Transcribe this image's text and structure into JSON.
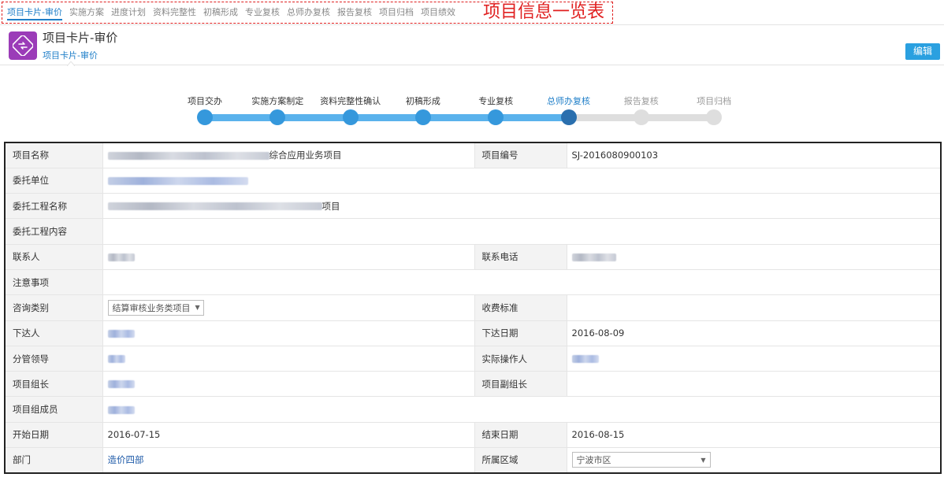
{
  "tabs": [
    {
      "label": "项目卡片-审价",
      "active": true
    },
    {
      "label": "实施方案"
    },
    {
      "label": "进度计划"
    },
    {
      "label": "资料完整性"
    },
    {
      "label": "初稿形成"
    },
    {
      "label": "专业复核"
    },
    {
      "label": "总师办复核"
    },
    {
      "label": "报告复核"
    },
    {
      "label": "项目归档"
    },
    {
      "label": "项目绩效"
    }
  ],
  "annotation": "项目信息一览表",
  "header": {
    "title": "项目卡片-审价",
    "subtitle": "项目卡片-审价",
    "edit_label": "编辑"
  },
  "steps": [
    {
      "label": "项目交办",
      "state": "done"
    },
    {
      "label": "实施方案制定",
      "state": "done"
    },
    {
      "label": "资料完整性确认",
      "state": "done"
    },
    {
      "label": "初稿形成",
      "state": "done"
    },
    {
      "label": "专业复核",
      "state": "done"
    },
    {
      "label": "总师办复核",
      "state": "current"
    },
    {
      "label": "报告复核",
      "state": "pending"
    },
    {
      "label": "项目归档",
      "state": "pending"
    }
  ],
  "form": {
    "project_name_label": "项目名称",
    "project_name_suffix": "综合应用业务项目",
    "project_no_label": "项目编号",
    "project_no": "SJ-2016080900103",
    "client_label": "委托单位",
    "work_name_label": "委托工程名称",
    "work_name_suffix": "项目",
    "work_content_label": "委托工程内容",
    "contact_label": "联系人",
    "phone_label": "联系电话",
    "notes_label": "注意事项",
    "category_label": "咨询类别",
    "category_value": "结算审核业务类项目",
    "fee_label": "收费标准",
    "assigner_label": "下达人",
    "assign_date_label": "下达日期",
    "assign_date": "2016-08-09",
    "leader_label": "分管领导",
    "operator_label": "实际操作人",
    "group_leader_label": "项目组长",
    "vice_leader_label": "项目副组长",
    "members_label": "项目组成员",
    "start_label": "开始日期",
    "start_date": "2016-07-15",
    "end_label": "结束日期",
    "end_date": "2016-08-15",
    "dept_label": "部门",
    "dept_value": "造价四部",
    "region_label": "所属区域",
    "region_value": "宁波市区"
  },
  "colors": {
    "accent": "#1e7ec8",
    "annotation": "#e02020",
    "app_icon": "#9b3cb8",
    "edit_button": "#2aa0e0",
    "progress_done": "#3598dc",
    "progress_current": "#2a6fae",
    "progress_pending": "#dedede"
  },
  "icons": {
    "app": "swap-arrows-icon"
  }
}
